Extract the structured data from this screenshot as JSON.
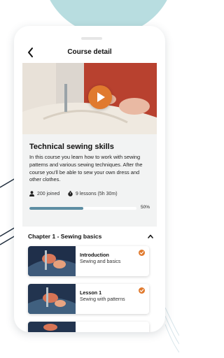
{
  "header": {
    "title": "Course detail"
  },
  "course": {
    "title": "Technical sewing skills",
    "description": "In this course you learn how to work with sewing patterns and various sewing techniques. After the course you'll be able to sew your own dress and other clothes.",
    "joined": "200 joined",
    "lessons": "9 lessons (5h 30m)",
    "progress_text": "50%",
    "progress_fraction": 0.5
  },
  "chapter": {
    "title": "Chapter 1 - Sewing basics",
    "lessons": [
      {
        "title": "Introduction",
        "subtitle": "Sewing and basics",
        "completed": true
      },
      {
        "title": "Lesson 1",
        "subtitle": "Sewing with patterns",
        "completed": true
      }
    ]
  },
  "colors": {
    "accent": "#e07a2e",
    "progress": "#5d8ea3",
    "blob": "#b8dde0"
  },
  "icons": {
    "back": "arrow-left-icon",
    "play": "play-icon",
    "people": "person-icon",
    "lessons": "stopwatch-icon",
    "collapse": "chevron-up-icon",
    "done": "check-circle-icon"
  }
}
